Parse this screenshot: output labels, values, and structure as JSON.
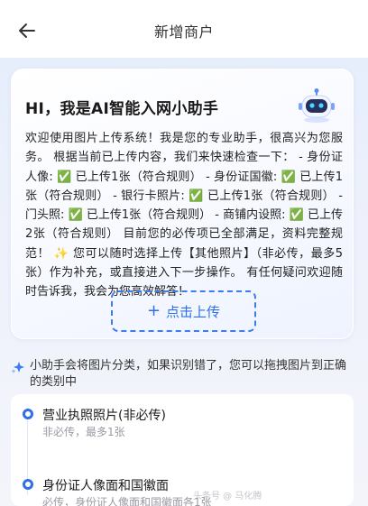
{
  "header": {
    "title": "新增商户",
    "back_icon": "arrow-left-icon"
  },
  "assistant_card": {
    "title": "HI，我是AI智能入网小助手",
    "robot_icon": "robot-icon",
    "message": "欢迎使用图片上传系统！我是您的专业助手，很高兴为您服务。 根据当前已上传内容，我们来快速检查一下： - 身份证人像: ✅ 已上传1张（符合规则） - 身份证国徽: ✅ 已上传1张（符合规则） - 银行卡照片: ✅ 已上传1张（符合规则） - 门头照: ✅ 已上传1张（符合规则） - 商铺内设照: ✅ 已上传2张（符合规则） 目前您的必传项已全部满足，资料完整规范！ ✨ 您可以随时选择上传【其他照片】（非必传，最多5张）作为补充，或直接进入下一步操作。 有任何疑问欢迎随时告诉我，我会为您高效解答！",
    "upload_button": {
      "icon": "plus-icon",
      "label": "点击上传"
    }
  },
  "hint": {
    "icon": "sparkle-icon",
    "text": "小助手会将图片分类，如果识别错了，您可以拖拽图片到正确的类别中"
  },
  "categories": [
    {
      "title": "营业执照照片(非必传)",
      "subtitle": "非必传，最多1张"
    },
    {
      "title": "身份证人像面和国徽面",
      "subtitle": "必传，身份证人像面和国徽面各1张"
    }
  ],
  "watermark": "头条号 @ 马化腾",
  "colors": {
    "accent": "#2f6fe8",
    "check": "#1fbf4f"
  }
}
